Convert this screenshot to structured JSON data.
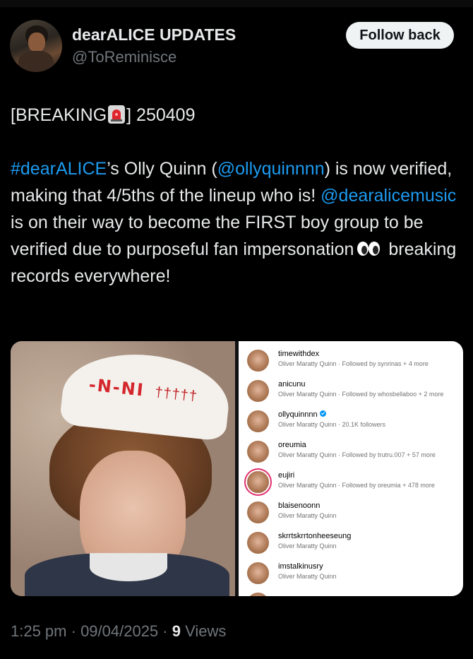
{
  "user": {
    "name": "dearALICE UPDATES",
    "handle": "@ToReminisce",
    "follow_label": "Follow back"
  },
  "tweet": {
    "line1_pre": "[BREAKING",
    "line1_post": "] 250409",
    "hashtag": "#dearALICE",
    "t1": "’s Olly Quinn (",
    "mention1": "@ollyquinnnn",
    "t2": ") is now verified, making that 4/5ths of the lineup who is! ",
    "mention2": "@dearalicemusic",
    "t3": " is on their way to become the FIRST boy group to be verified due to purposeful fan impersonation",
    "t4": " breaking records everywhere!"
  },
  "photo": {
    "hat_text": "-N-NI",
    "palms": "†††††"
  },
  "accounts": [
    {
      "username": "timewithdex",
      "subtitle": "Oliver Maratty Quinn · Followed by synrinas + 4 more",
      "verified": false,
      "story": false
    },
    {
      "username": "anicunu",
      "subtitle": "Oliver Maratty Quinn · Followed by whosbellaboo + 2 more",
      "verified": false,
      "story": false
    },
    {
      "username": "ollyquinnnn",
      "subtitle": "Oliver Maratty Quinn · 20.1K followers",
      "verified": true,
      "story": false
    },
    {
      "username": "oreumia",
      "subtitle": "Oliver Maratty Quinn · Followed by trutru.007 + 57 more",
      "verified": false,
      "story": false
    },
    {
      "username": "eujiri",
      "subtitle": "Oliver Maratty Quinn · Followed by oreumia + 478 more",
      "verified": false,
      "story": true
    },
    {
      "username": "blaisenoonn",
      "subtitle": "Oliver Maratty Quinn",
      "verified": false,
      "story": false
    },
    {
      "username": "skrrtskrrtonheeseung",
      "subtitle": "Oliver Maratty Quinn",
      "verified": false,
      "story": false
    },
    {
      "username": "imstalkinusry",
      "subtitle": "Oliver Maratty Quinn",
      "verified": false,
      "story": false
    }
  ],
  "footer": {
    "time": "1:25 pm",
    "sep1": " · ",
    "date": "09/04/2025",
    "sep2": " · ",
    "views_count": "9",
    "views_label": " Views"
  },
  "colors": {
    "accent": "#1d9bf0",
    "text": "#e7e9ea",
    "muted": "#71767b",
    "background": "#000000"
  }
}
